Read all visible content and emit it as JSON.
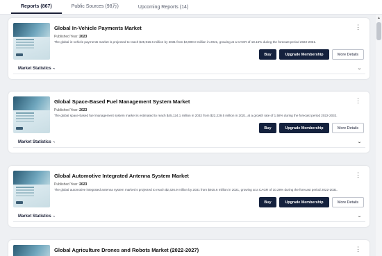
{
  "tabs": [
    {
      "label": "Reports (867)",
      "active": true
    },
    {
      "label": "Public Sources (98万)",
      "active": false
    },
    {
      "label": "Upcoming Reports (14)",
      "active": false
    }
  ],
  "cards": [
    {
      "title": "Global In-Vehicle Payments Market",
      "year_label": "Published Year:",
      "year": "2023",
      "description": "The global in-vehicle payments market is projected to reach $25,916.6 million by 2031 from $4,900.0 million in 2021, growing at a CAGR of 18.15% during the forecast period 2022-2031.",
      "buy": "Buy",
      "upgrade": "Upgrade Membership",
      "more": "More Details",
      "stats": "Market Statistics",
      "stats_tick": "¬"
    },
    {
      "title": "Global Space-Based Fuel Management System Market",
      "year_label": "Published Year:",
      "year": "2023",
      "description": "The global space-based fuel management system market is estimated to reach $45,124.1 million in 2032 from $22,229.5 million in 2021, at a growth rate of 1.58% during the forecast period 2022-2032.",
      "buy": "Buy",
      "upgrade": "Upgrade Membership",
      "more": "More Details",
      "stats": "Market Statistics",
      "stats_tick": "¬"
    },
    {
      "title": "Global Automotive Integrated Antenna System Market",
      "year_label": "Published Year:",
      "year": "2023",
      "description": "The global automotive integrated antenna system market is projected to reach $2,426.9 million by 2031 from $915.6 million in 2021, growing at a CAGR of 10.28% during the forecast period 2022-2031.",
      "buy": "Buy",
      "upgrade": "Upgrade Membership",
      "more": "More Details",
      "stats": "Market Statistics",
      "stats_tick": "¬"
    },
    {
      "title": "Global Agriculture Drones and Robots Market (2022-2027)"
    }
  ],
  "icons": {
    "kebab": "⋮",
    "chevron": "⌄",
    "scroll_up": "▲"
  },
  "colors": {
    "primary_button": "#14213d",
    "background": "#eef0f3"
  }
}
